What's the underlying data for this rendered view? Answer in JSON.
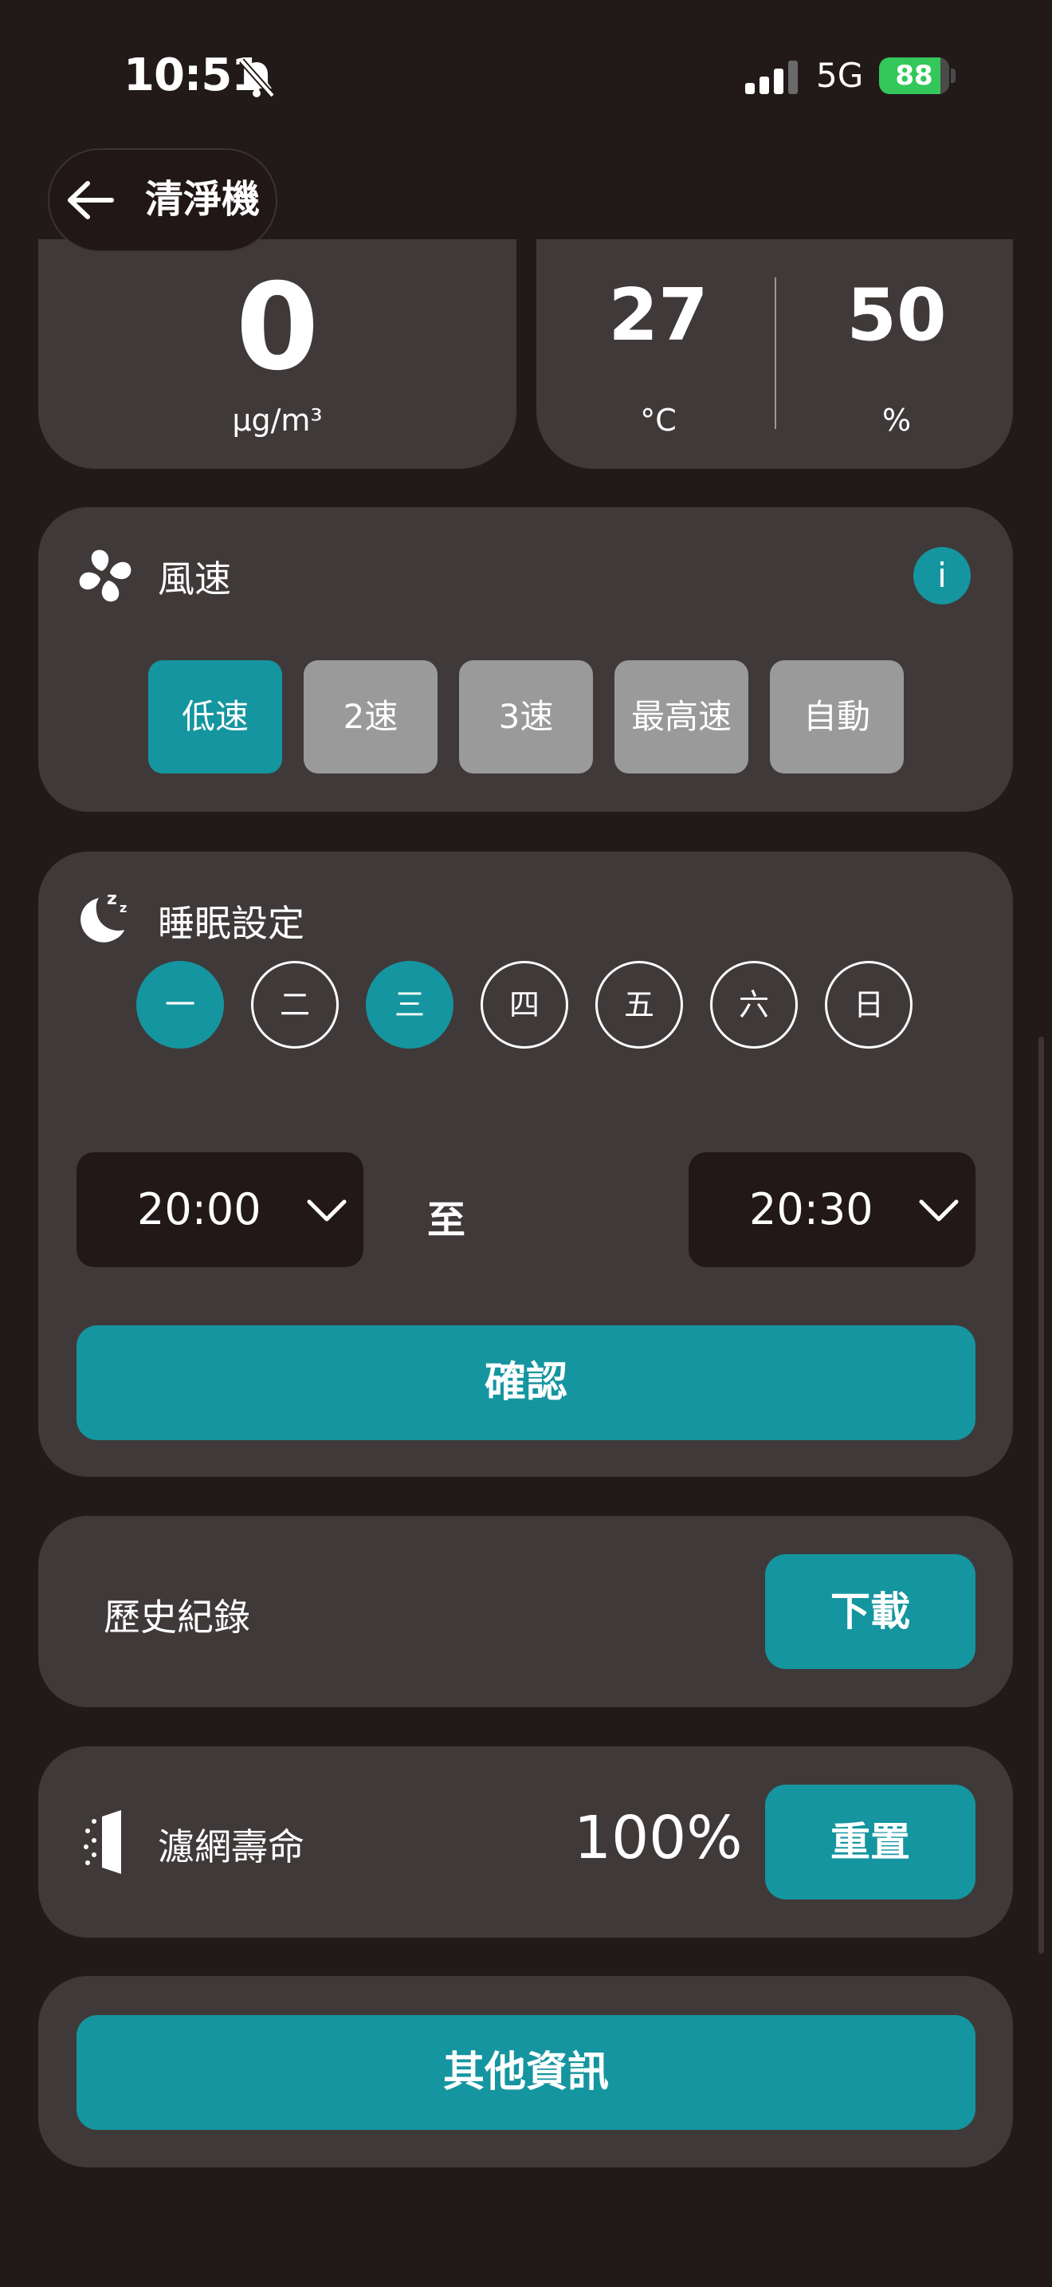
{
  "status_bar": {
    "time": "10:51",
    "network": "5G",
    "battery": "88",
    "battery_level": 0.88,
    "icons": [
      "bell-muted-icon",
      "signal-icon",
      "battery-charging-icon"
    ]
  },
  "header": {
    "title": "清淨機",
    "back_icon": "arrow-left-icon"
  },
  "readings": {
    "pm25": {
      "value": "0",
      "unit": "µg/m³"
    },
    "temperature": {
      "value": "27",
      "unit": "°C"
    },
    "humidity": {
      "value": "50",
      "unit": "%"
    }
  },
  "fan_speed": {
    "title": "風速",
    "icon": "fan-icon",
    "info_label": "i",
    "options": [
      "低速",
      "2速",
      "3速",
      "最高速",
      "自動"
    ],
    "selected": "低速"
  },
  "sleep": {
    "title": "睡眠設定",
    "icon": "moon-zzz-icon",
    "days": [
      "一",
      "二",
      "三",
      "四",
      "五",
      "六",
      "日"
    ],
    "selected_days": [
      "一",
      "三"
    ],
    "start_time": "20:00",
    "to_label": "至",
    "end_time": "20:30",
    "confirm_label": "確認"
  },
  "history": {
    "label": "歷史紀錄",
    "download_label": "下載"
  },
  "filter": {
    "label": "濾網壽命",
    "icon": "filter-icon",
    "value": "100%",
    "reset_label": "重置"
  },
  "other_info": {
    "label": "其他資訊"
  },
  "colors": {
    "background": "#221a19",
    "card": "#3f3a39",
    "accent": "#15959f",
    "inactive": "#9a9a9a"
  }
}
